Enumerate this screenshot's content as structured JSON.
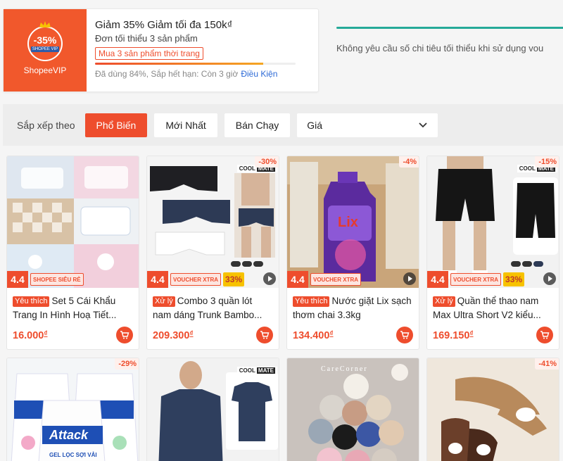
{
  "voucher": {
    "badge_percent": "-35%",
    "badge_tag": "SHOPEE VIP",
    "brand": "ShopeeVIP",
    "title": "Giảm 35% Giảm tối đa 150k₫",
    "min_order": "Đơn tối thiểu 3 sản phẩm",
    "chip": "Mua 3 sản phẩm thời trang",
    "used_fraction": 0.84,
    "meta": "Đã dùng 84%, Sắp hết hạn: Còn 3 giờ",
    "terms_link": "Điều Kiện"
  },
  "info": {
    "text": "Không yêu cầu số chi tiêu tối thiểu khi sử dụng vou"
  },
  "sort": {
    "label": "Sắp xếp theo",
    "options": [
      "Phổ Biến",
      "Mới Nhất",
      "Bán Chạy"
    ],
    "active": "Phổ Biến",
    "price_select": "Giá"
  },
  "colors": {
    "accent": "#ee4d2d",
    "teal": "#26aa99"
  },
  "products": [
    {
      "discount": "",
      "tag": "Yêu thích",
      "title": "Set 5 Cái Khẩu Trang In Hình Hoạ Tiết...",
      "price": "16.000",
      "currency": "₫",
      "promo44": "4.4",
      "pill": "SHOPEE SIÊU RẺ",
      "promo33": "",
      "icon": "cart-icon"
    },
    {
      "discount": "-30%",
      "tag": "Xử lý",
      "title": "Combo 3 quần lót nam dáng Trunk Bambo...",
      "price": "209.300",
      "currency": "₫",
      "promo44": "4.4",
      "pill": "VOUCHER XTRA",
      "promo33": "33%",
      "icon": "cart-icon"
    },
    {
      "discount": "-4%",
      "tag": "Yêu thích",
      "title": "Nước giặt Lix sạch thơm chai 3.3kg",
      "price": "134.400",
      "currency": "₫",
      "promo44": "4.4",
      "pill": "VOUCHER XTRA",
      "promo33": "",
      "icon": "cart-icon"
    },
    {
      "discount": "-15%",
      "tag": "Xử lý",
      "title": "Quần thể thao nam Max Ultra Short V2 kiểu...",
      "price": "169.150",
      "currency": "₫",
      "promo44": "4.4",
      "pill": "VOUCHER XTRA",
      "promo33": "33%",
      "icon": "cart-icon"
    },
    {
      "discount": "-29%",
      "tag": "",
      "title": "",
      "price": "",
      "currency": "",
      "promo44": "",
      "pill": "",
      "promo33": "",
      "icon": ""
    },
    {
      "discount": "",
      "tag": "",
      "title": "",
      "price": "",
      "currency": "",
      "promo44": "",
      "pill": "",
      "promo33": "",
      "icon": ""
    },
    {
      "discount": "",
      "tag": "",
      "title": "",
      "price": "",
      "currency": "",
      "promo44": "",
      "pill": "",
      "promo33": "",
      "icon": ""
    },
    {
      "discount": "-41%",
      "tag": "",
      "title": "",
      "price": "",
      "currency": "",
      "promo44": "",
      "pill": "",
      "promo33": "",
      "icon": ""
    }
  ],
  "image_text": {
    "coolmate": "COOL",
    "coolmate_b": "MATE",
    "attack": "Attack",
    "attack_sub": "GEL LỌC SỢI VẢI",
    "lix": "Lix",
    "carecorner": "CareCorner"
  }
}
